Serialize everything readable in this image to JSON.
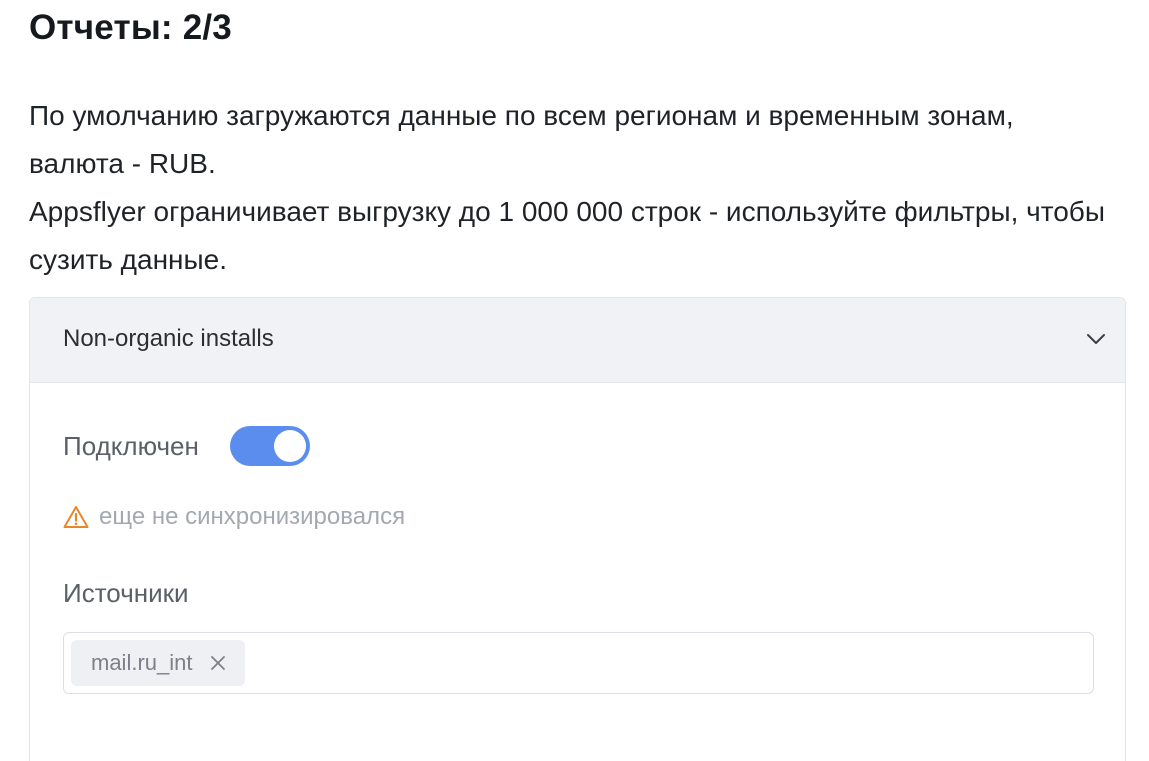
{
  "header": {
    "title": "Отчеты: 2/3"
  },
  "description": {
    "line1": "По умолчанию загружаются данные по всем регионам и временным зонам, валюта - RUB.",
    "line2": "Appsflyer ограничивает выгрузку до 1 000 000 строк - используйте фильтры, чтобы сузить данные."
  },
  "report": {
    "name": "Non-organic installs",
    "expand_icon": "chevron-down-icon",
    "connected_label": "Подключен",
    "connected": true,
    "sync_status_icon": "warning-icon",
    "sync_status": "еще не синхронизировался",
    "sources_label": "Источники",
    "sources": [
      {
        "label": "mail.ru_int",
        "remove_icon": "close-icon"
      }
    ]
  },
  "colors": {
    "toggle_on": "#5b8def",
    "warning": "#e8862a",
    "header_bg": "#f1f2f5"
  }
}
